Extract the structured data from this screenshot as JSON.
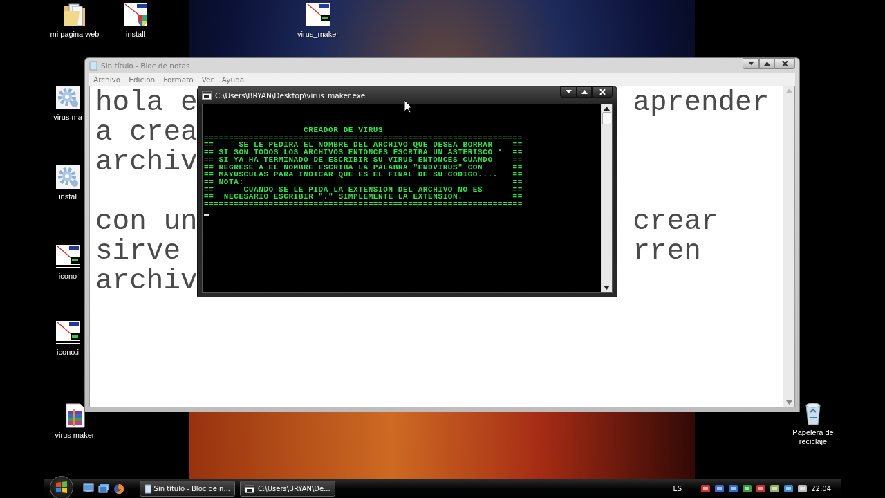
{
  "desktop_icons": [
    {
      "label": "mi pagina web",
      "kind": "folder"
    },
    {
      "label": "install",
      "kind": "shield-app"
    },
    {
      "label": "virus_maker",
      "kind": "virus-app"
    },
    {
      "label": "virus ma",
      "kind": "gear"
    },
    {
      "label": "instal",
      "kind": "gear"
    },
    {
      "label": "icono",
      "kind": "thumbnail"
    },
    {
      "label": "icono.i",
      "kind": "thumbnail"
    },
    {
      "label": "virus maker",
      "kind": "archive"
    },
    {
      "label": "Papelera de reciclaje",
      "kind": "recycle-bin"
    }
  ],
  "notepad": {
    "title": "Sin título - Bloc de notas",
    "menu": [
      "Archivo",
      "Edición",
      "Formato",
      "Ver",
      "Ayuda"
    ],
    "paragraphs": [
      {
        "lines": [
          {
            "left": "hola e",
            "right": "aprender"
          },
          {
            "left": "a crea"
          },
          {
            "left": "archiv"
          }
        ]
      },
      {
        "lines": [
          {
            "left": "con un",
            "right": "crear"
          },
          {
            "left": "sirve",
            "right": "rren"
          },
          {
            "left": "archiv"
          }
        ]
      }
    ]
  },
  "console": {
    "title": "C:\\Users\\BRYAN\\Desktop\\virus_maker.exe",
    "lines": [
      "                    CREADOR DE VIRUS",
      "================================================================",
      "==     SE LE PEDIRA EL NOMBRE DEL ARCHIVO QUE DESEA BORRAR    ==",
      "== SI SON TODOS LOS ARCHIVOS ENTONCES ESCRIBA UN ASTERISCO *  ==",
      "== SI YA HA TERMINADO DE ESCRIBIR SU VIRUS ENTONCES CUANDO    ==",
      "== REGRESE A EL NOMBRE ESCRIBA LA PALABRA \"ENDVIRUS\" CON      ==",
      "== MAYUSCULAS PARA INDICAR QUE ES EL FINAL DE SU CODIGO....   ==",
      "== NOTA:                                                      ==",
      "==      CUANDO SE LE PIDA LA EXTENSION DEL ARCHIVO NO ES      ==",
      "==  NECESARIO ESCRIBIR \".\" SIMPLEMENTE LA EXTENSION.          ==",
      "================================================================"
    ]
  },
  "taskbar": {
    "tasks": [
      {
        "label": "Sin título - Bloc de n...",
        "kind": "notepad"
      },
      {
        "label": "C:\\Users\\BRYAN\\De...",
        "kind": "console"
      }
    ],
    "language": "ES",
    "clock": "22:04"
  }
}
